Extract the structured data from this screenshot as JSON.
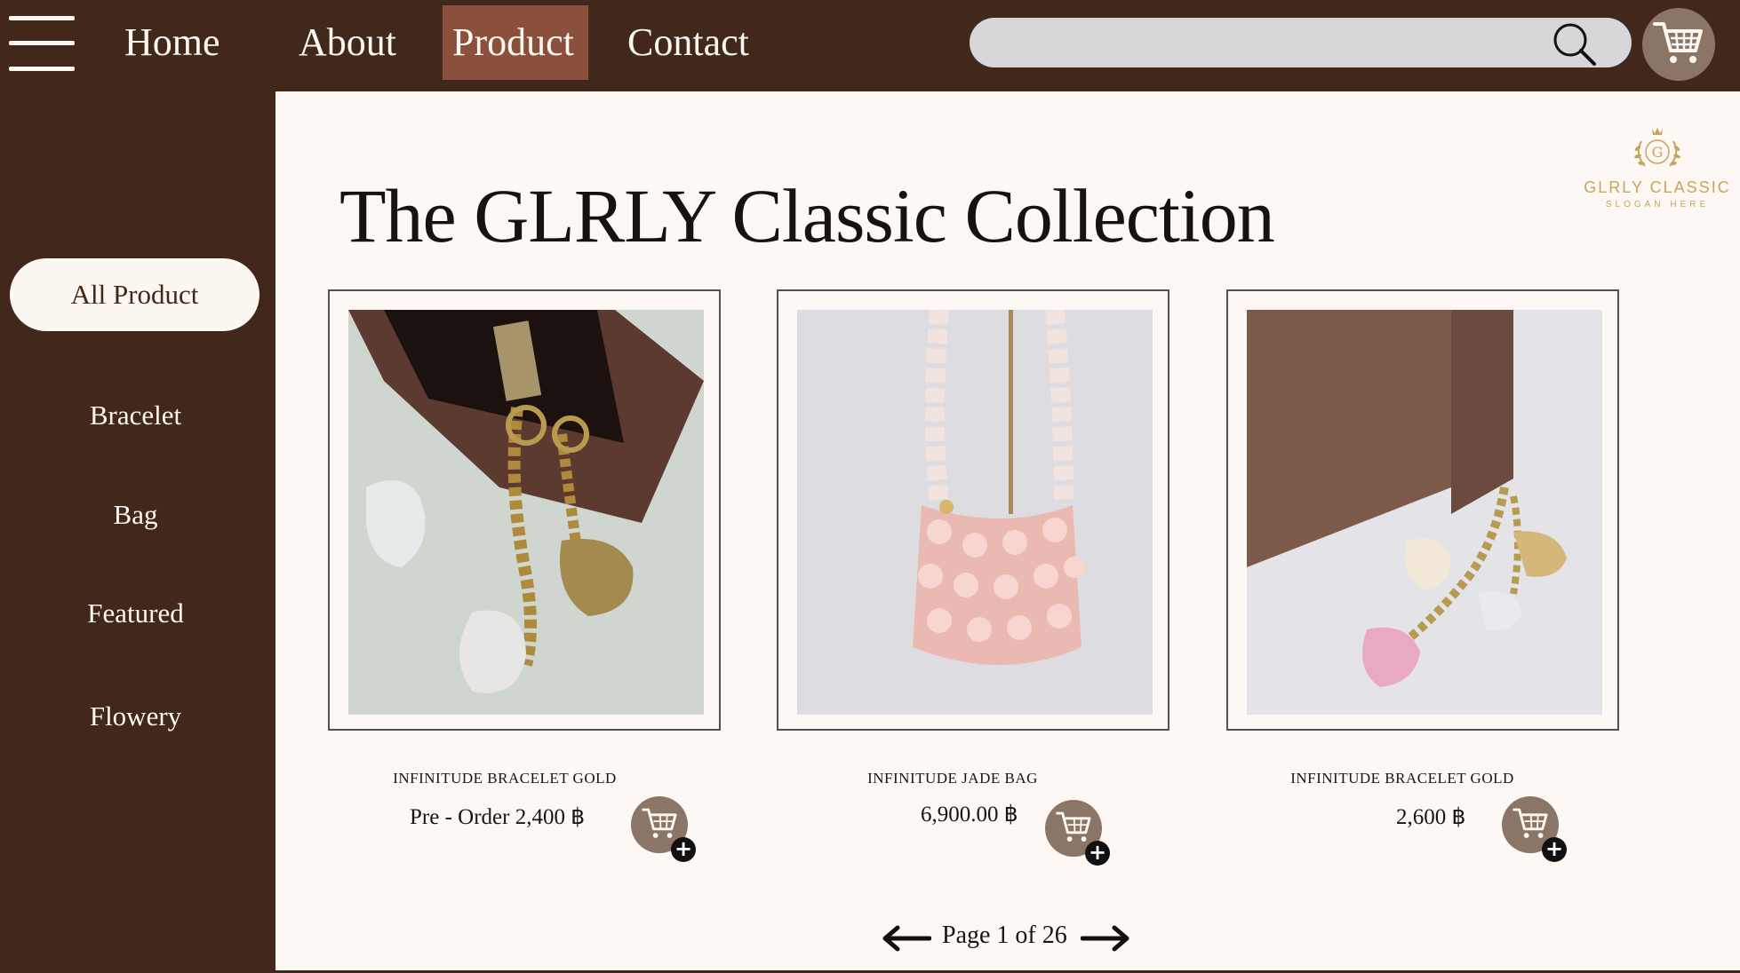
{
  "nav": {
    "items": [
      "Home",
      "About",
      "Product",
      "Contact"
    ],
    "active": "Product"
  },
  "search": {
    "placeholder": ""
  },
  "sidebar": {
    "items": [
      {
        "label": "All Product",
        "active": true
      },
      {
        "label": "Bracelet",
        "active": false
      },
      {
        "label": "Bag",
        "active": false
      },
      {
        "label": "Featured",
        "active": false
      },
      {
        "label": "Flowery",
        "active": false
      }
    ]
  },
  "page": {
    "title": "The GLRLY Classic Collection"
  },
  "brand": {
    "initial": "G",
    "name": "GLRLY CLASSIC",
    "slogan": "SLOGAN HERE"
  },
  "products": [
    {
      "name": "INFINITUDE BRACELET GOLD",
      "price": "Pre - Order 2,400 ฿"
    },
    {
      "name": "INFINITUDE JADE BAG",
      "price": "6,900.00 ฿"
    },
    {
      "name": "INFINITUDE BRACELET GOLD",
      "price": "2,600 ฿"
    }
  ],
  "pagination": {
    "text": "Page 1 of 26"
  },
  "colors": {
    "primary": "#42271b",
    "active_nav": "#8a503b",
    "background": "#fdf8f4",
    "cart_button": "#8a7567",
    "gold": "#c8a55a"
  }
}
